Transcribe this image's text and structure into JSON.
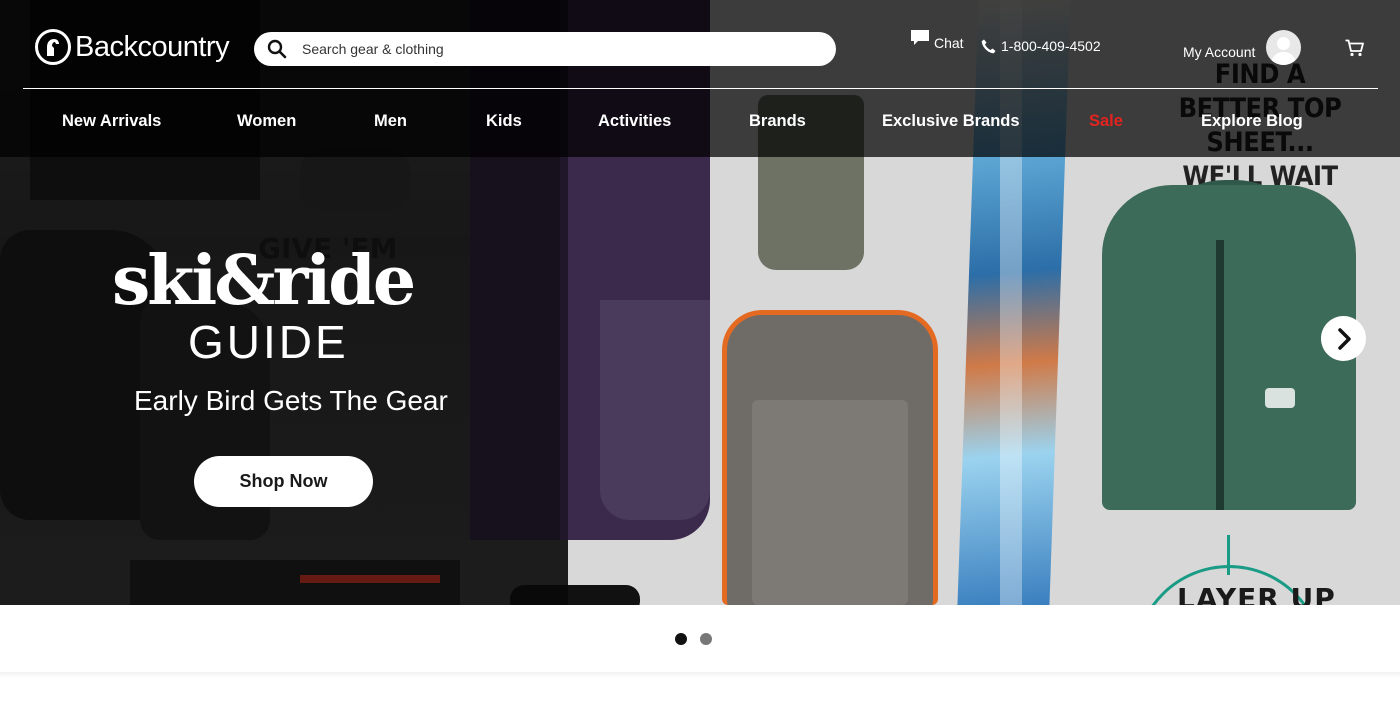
{
  "brand": {
    "name": "Backcountry"
  },
  "search": {
    "placeholder": "Search gear & clothing"
  },
  "utility": {
    "chat_label": "Chat",
    "phone_label": "1-800-409-4502",
    "account_label": "My Account"
  },
  "nav": {
    "items": [
      {
        "label": "New Arrivals"
      },
      {
        "label": "Women"
      },
      {
        "label": "Men"
      },
      {
        "label": "Kids"
      },
      {
        "label": "Activities"
      },
      {
        "label": "Brands"
      },
      {
        "label": "Exclusive Brands"
      },
      {
        "label": "Sale",
        "color": "#e4231f"
      },
      {
        "label": "Explore Blog"
      }
    ]
  },
  "hero": {
    "title": "ski&ride",
    "title_line2": "GUIDE",
    "subtitle": "Early Bird Gets The Gear",
    "cta_label": "Shop Now",
    "image_text": {
      "give_em": "GIVE 'EM",
      "find_better": "FIND A BETTER TOP SHEET... WE'LL WAIT",
      "layer_up": "LAYER UP"
    }
  },
  "carousel": {
    "slide_count": 2,
    "active_slide": 1
  },
  "colors": {
    "header_bg": "#000000",
    "sale": "#e4231f",
    "white": "#ffffff",
    "dot_active": "#111111",
    "dot_inactive": "#777777"
  },
  "icons": {
    "logo": "backcountry-goat-icon",
    "search": "search-icon",
    "chat": "chat-bubble-icon",
    "phone": "phone-icon",
    "account": "avatar",
    "cart": "cart-icon",
    "next": "chevron-right-icon"
  }
}
